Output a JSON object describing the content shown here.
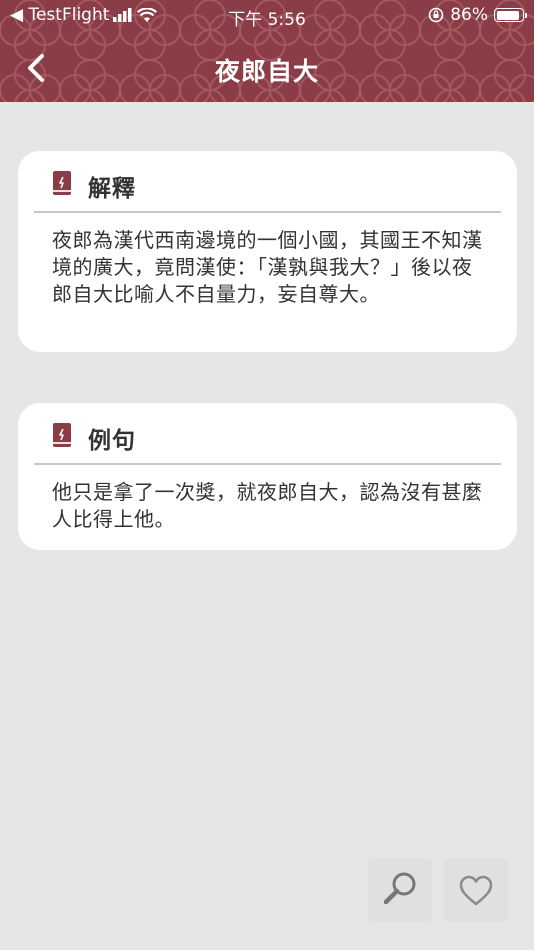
{
  "status_bar": {
    "back_app": "◀ TestFlight",
    "time": "下午 5:56",
    "battery_percent": "86%",
    "battery_level": 0.86
  },
  "nav": {
    "title": "夜郎自大"
  },
  "cards": [
    {
      "title": "解釋",
      "body": "夜郎為漢代西南邊境的一個小國，其國王不知漢境的廣大，竟問漢使：「漢孰與我大？」後以夜郎自大比喻人不自量力，妄自尊大。"
    },
    {
      "title": "例句",
      "body": "他只是拿了一次獎，就夜郎自大，認為沒有甚麼人比得上他。"
    }
  ],
  "actions": {
    "search_icon": "search-icon",
    "favorite_icon": "heart-outline-icon"
  },
  "colors": {
    "header": "#8a3d47",
    "background": "#e6e6e6",
    "card": "#ffffff",
    "icon_accent": "#8a3d47"
  }
}
